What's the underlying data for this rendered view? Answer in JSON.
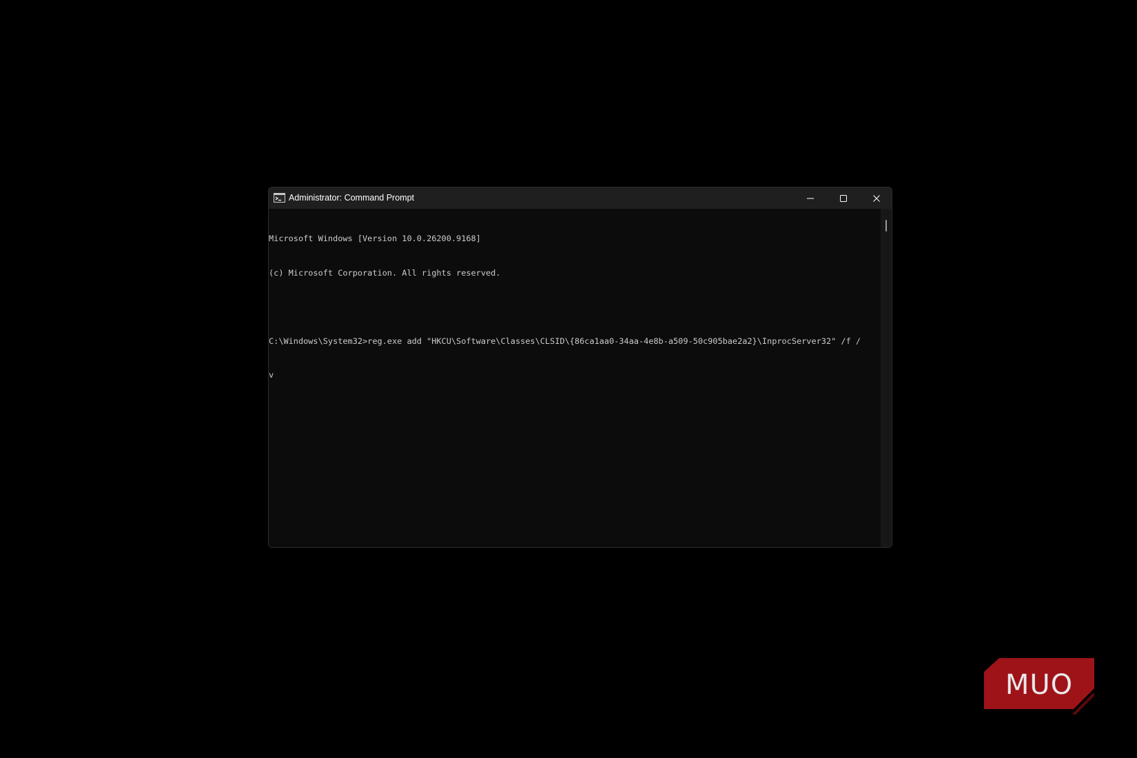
{
  "window": {
    "title": "Administrator: Command Prompt",
    "icon": "cmd-icon"
  },
  "console": {
    "lines": [
      "Microsoft Windows [Version 10.0.26200.9168]",
      "(c) Microsoft Corporation. All rights reserved.",
      "",
      "C:\\Windows\\System32>reg.exe add \"HKCU\\Software\\Classes\\CLSID\\{86ca1aa0-34aa-4e8b-a509-50c905bae2a2}\\InprocServer32\" /f /",
      "v"
    ]
  },
  "watermark": {
    "text": "MUO",
    "color": "#c4161c"
  },
  "colors": {
    "titlebar": "#1f1f1f",
    "console_bg": "#0c0c0c",
    "console_text": "#cccccc"
  }
}
